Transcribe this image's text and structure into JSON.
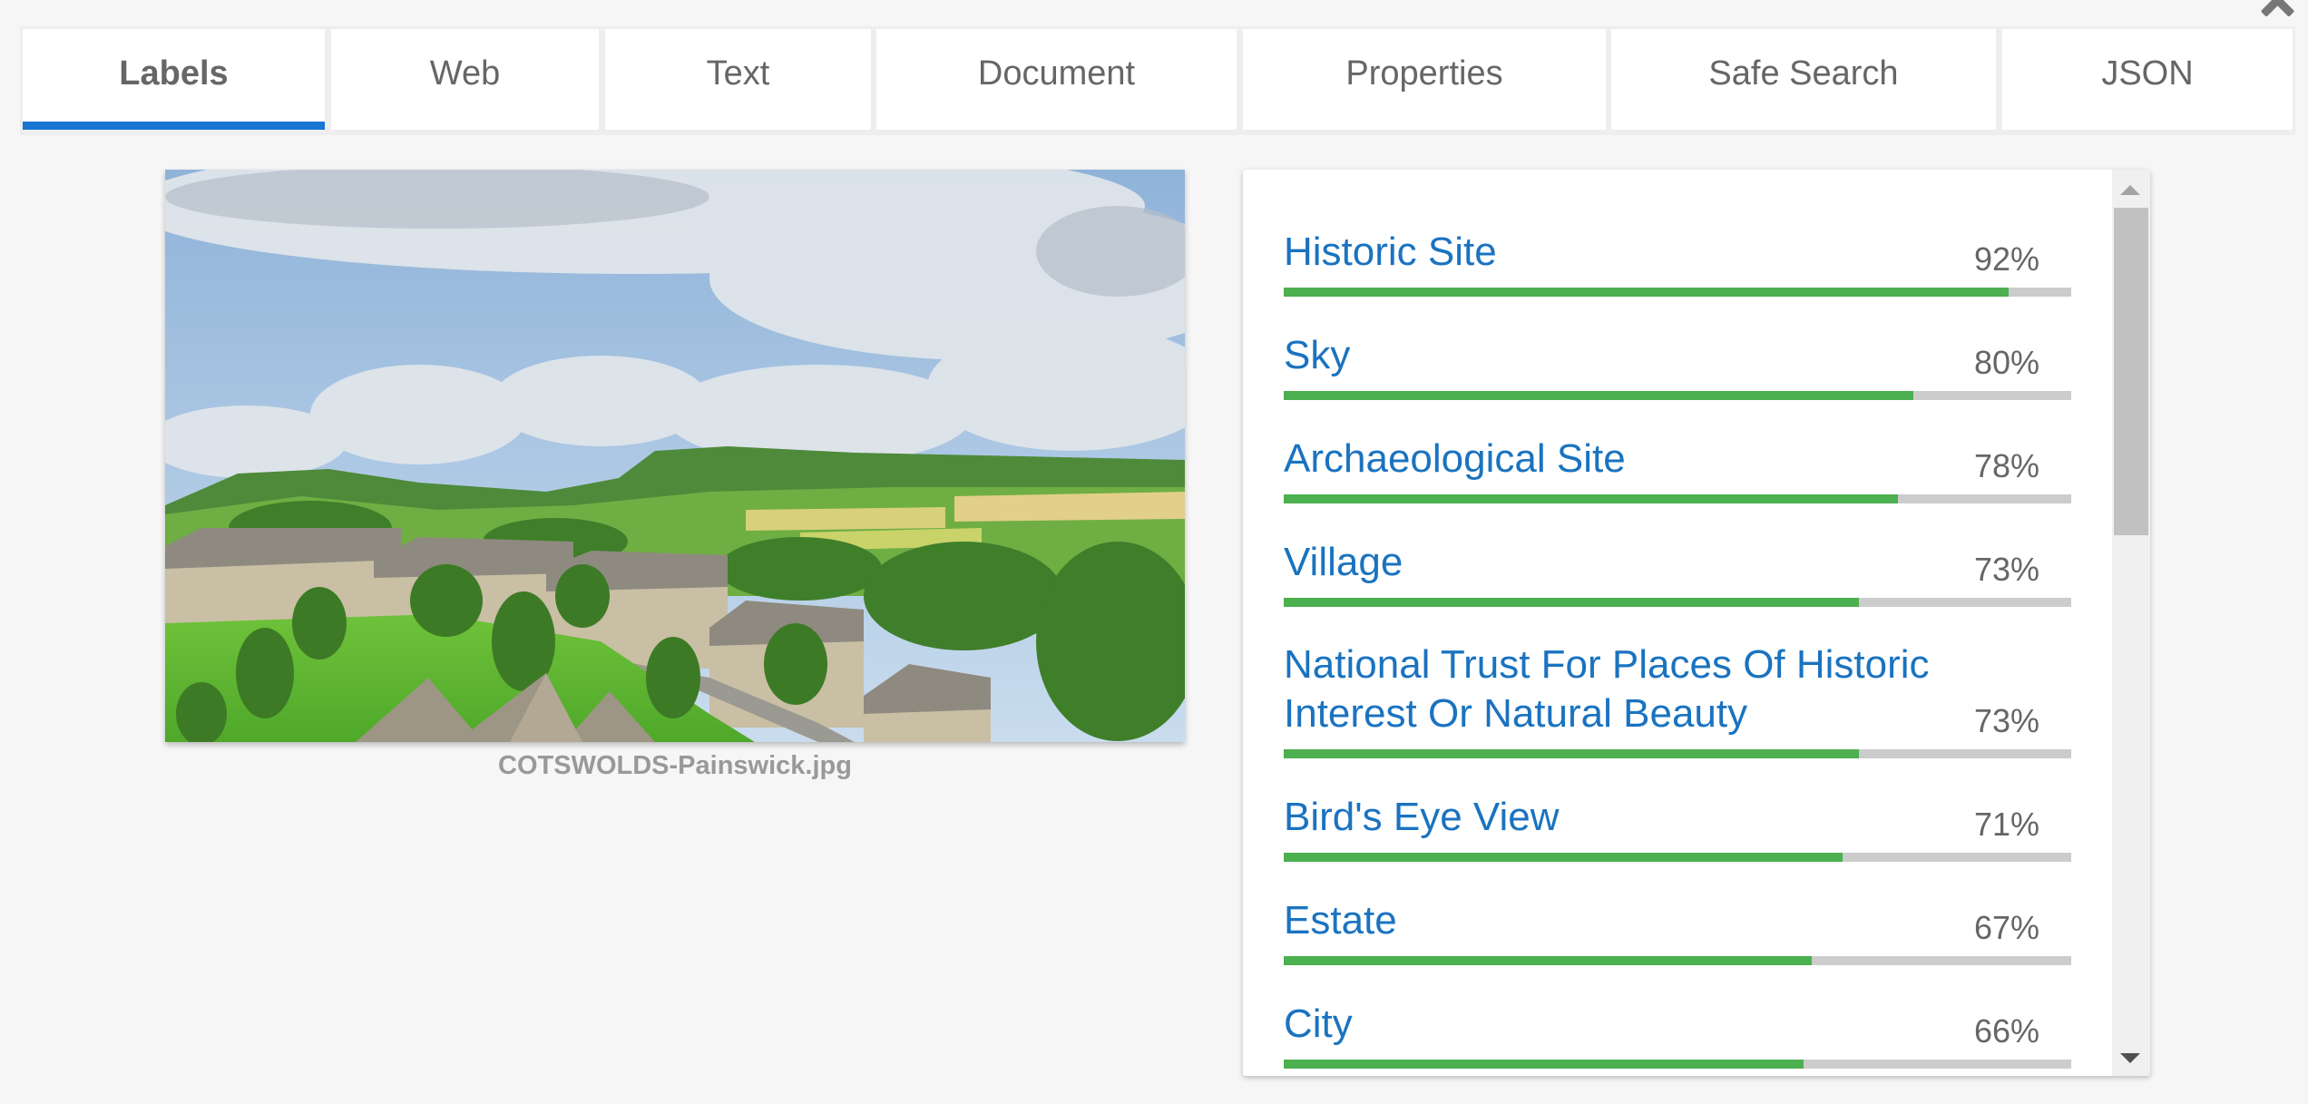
{
  "close_icon": "close-icon",
  "tabs": [
    {
      "label": "Labels",
      "active": true
    },
    {
      "label": "Web",
      "active": false
    },
    {
      "label": "Text",
      "active": false
    },
    {
      "label": "Document",
      "active": false
    },
    {
      "label": "Properties",
      "active": false
    },
    {
      "label": "Safe Search",
      "active": false
    },
    {
      "label": "JSON",
      "active": false
    }
  ],
  "image": {
    "filename": "COTSWOLDS-Painswick.jpg",
    "description": "Aerial view of a Cotswolds village with churchyard yew trees, stone houses and green rolling hills under a cloudy sky"
  },
  "labels": [
    {
      "name": "Historic Site",
      "score": 92,
      "score_text": "92%"
    },
    {
      "name": "Sky",
      "score": 80,
      "score_text": "80%"
    },
    {
      "name": "Archaeological Site",
      "score": 78,
      "score_text": "78%"
    },
    {
      "name": "Village",
      "score": 73,
      "score_text": "73%"
    },
    {
      "name": "National Trust For Places Of Historic Interest Or Natural Beauty",
      "score": 73,
      "score_text": "73%"
    },
    {
      "name": "Bird's Eye View",
      "score": 71,
      "score_text": "71%"
    },
    {
      "name": "Estate",
      "score": 67,
      "score_text": "67%"
    },
    {
      "name": "City",
      "score": 66,
      "score_text": "66%"
    }
  ],
  "scrollbar": {
    "position_fraction": 0.0,
    "visible_fraction": 0.38
  },
  "colors": {
    "accent": "#1976d2",
    "label_text": "#1a73c0",
    "bar_fill": "#4caf50",
    "bar_track": "#cccccc",
    "tab_text": "#666666"
  }
}
